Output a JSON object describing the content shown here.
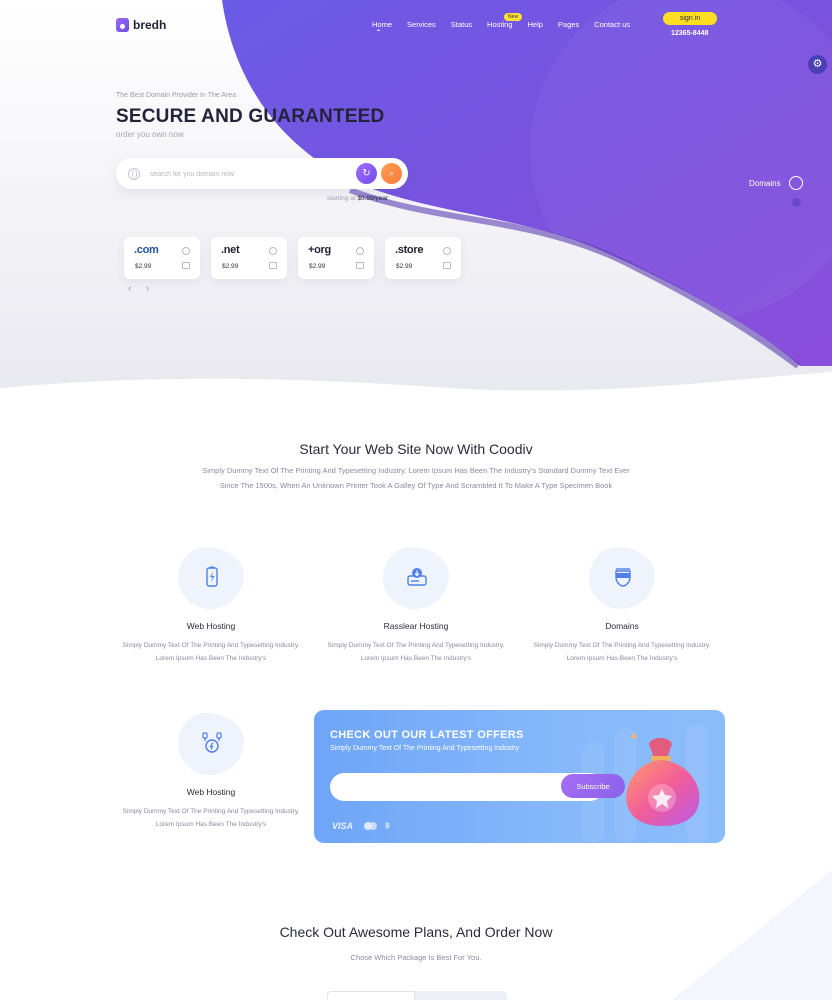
{
  "brand": {
    "name": "bredh"
  },
  "nav": {
    "items": [
      {
        "label": "Home"
      },
      {
        "label": "Services"
      },
      {
        "label": "Status"
      },
      {
        "label": "Hosting"
      },
      {
        "label": "Help"
      },
      {
        "label": "Pages"
      },
      {
        "label": "Contact us"
      }
    ],
    "new_badge": "New",
    "signin_label": "sign in",
    "phone": "12365-8448"
  },
  "hero": {
    "eyebrow": "The Best Domain Provider In The Area",
    "title": "SECURE AND GUARANTEED",
    "subtitle": "order you own now",
    "search_placeholder": "search for you domain now",
    "starting_prefix": "starting at",
    "starting_price": "$0.99/year",
    "domains_label": "Domains",
    "tlds": [
      {
        "name": ".com",
        "price": "$2.99",
        "color": "#1f4fa3"
      },
      {
        "name": ".net",
        "price": "$2.99",
        "color": "#1b1b2a"
      },
      {
        "name": "+org",
        "price": "$2.99",
        "color": "#1b1b2a"
      },
      {
        "name": ".store",
        "price": "$2.99",
        "color": "#1b1b2a"
      }
    ]
  },
  "intro": {
    "title": "Start Your Web Site Now With Coodiv",
    "description": "Simply Dummy Text Of The Printing And Typesetting Industry. Lorem Ipsum Has Been The Industry's Standard Dummy Text Ever Since The 1500s, When An Unknown Printer Took A Galley Of Type And Scrambled It To Make A Type Specimen Book"
  },
  "features": [
    {
      "title": "Web Hosting",
      "text": "Simply Dummy Text Of The Printing And Typesetting Industry. Lorem Ipsum Has Been The Industry's",
      "icon": "battery-bolt-icon"
    },
    {
      "title": "Rasslear Hosting",
      "text": "Simply Dummy Text Of The Printing And Typesetting Industry. Lorem Ipsum Has Been The Industry's",
      "icon": "server-download-icon"
    },
    {
      "title": "Domains",
      "text": "Simply Dummy Text Of The Printing And Typesetting Industry. Lorem Ipsum Has Been The Industry's",
      "icon": "vr-headset-icon"
    },
    {
      "title": "Web Hosting",
      "text": "Simply Dummy Text Of The Printing And Typesetting Industry. Lorem Ipsum Has Been The Industry's",
      "icon": "plug-cable-icon"
    }
  ],
  "offer": {
    "title": "CHECK OUT OUR LATEST OFFERS",
    "subtitle": "Simply Dummy Text Of The Printing And Typesetting Industry",
    "subscribe_label": "Subscribe",
    "visa": "VISA",
    "btc": "฿"
  },
  "plans": {
    "title": "Check Out Awesome Plans, And Order Now",
    "subtitle": "Chose Which Package Is Best For You."
  },
  "colors": {
    "accent_purple": "#7a4fe0",
    "accent_orange": "#ff8a45",
    "signin_yellow": "#ffde22",
    "offer_blue": "#7aaef8"
  }
}
